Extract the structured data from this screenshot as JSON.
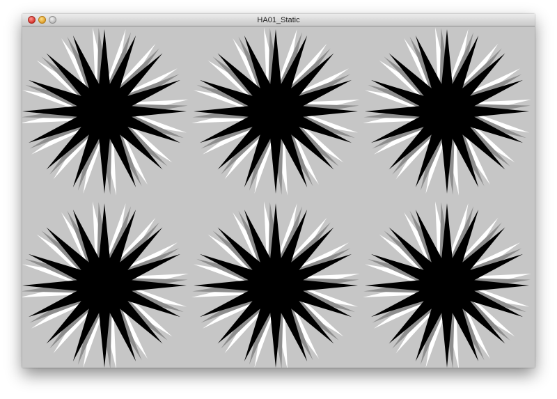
{
  "window": {
    "title": "HA01_Static"
  },
  "colors": {
    "background": "#c6c6c6",
    "layer_white": "#ffffff",
    "layer_gray": "#8e8e8e",
    "layer_black": "#000000"
  },
  "icons": {
    "close": "close-icon",
    "minimize": "minimize-icon",
    "zoom": "zoom-icon"
  },
  "canvas": {
    "grid_rows": 2,
    "grid_cols": 3,
    "star_points": 16,
    "layers": [
      "white",
      "gray",
      "black"
    ]
  }
}
